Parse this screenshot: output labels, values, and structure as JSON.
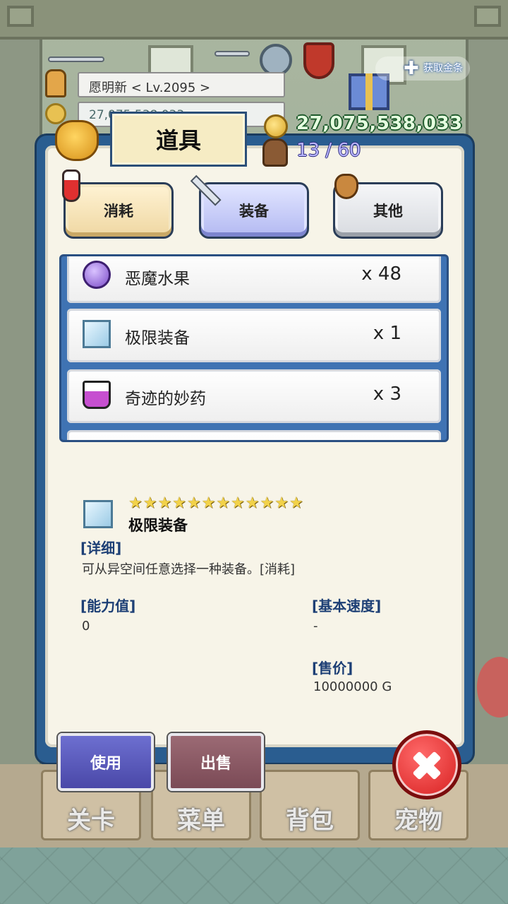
{
  "header": {
    "player_name_level": "愿明新    < Lv.2095 >",
    "gold_small": "27,075,538,033",
    "get_gold_label": "获取金条"
  },
  "panel": {
    "title": "道具",
    "gold": "27,075,538,033",
    "capacity": "13 / 60"
  },
  "tabs": [
    {
      "label": "消耗"
    },
    {
      "label": "装备",
      "active": true
    },
    {
      "label": "其他"
    }
  ],
  "items": [
    {
      "name": "恶魔水果",
      "qty": "x 48",
      "icon": "purple-fruit-icon"
    },
    {
      "name": "极限装备",
      "qty": "x 1",
      "icon": "crystal-cube-icon"
    },
    {
      "name": "奇迹的妙药",
      "qty": "x 3",
      "icon": "potion-flask-icon"
    }
  ],
  "detail": {
    "stars": "★★★★★★★★★★★★",
    "star_count": 12,
    "name": "极限装备",
    "detail_label": "[详细]",
    "description": "可从异空间任意选择一种装备。[消耗]",
    "ability_label": "[能力值]",
    "ability_value": "0",
    "speed_label": "[基本速度]",
    "speed_value": "-",
    "price_label": "[售价]",
    "price_value": "10000000 G"
  },
  "actions": {
    "use_label": "使用",
    "sell_label": "出售"
  },
  "bottom_nav": [
    {
      "label": "关卡"
    },
    {
      "label": "菜单"
    },
    {
      "label": "背包"
    },
    {
      "label": "宠物"
    }
  ],
  "colors": {
    "panel_border": "#2a5d90",
    "panel_bg": "#f7f4e8",
    "label_blue": "#1d3f75",
    "gold_text": "#e6ffe0",
    "close_red": "#d61e1e"
  }
}
